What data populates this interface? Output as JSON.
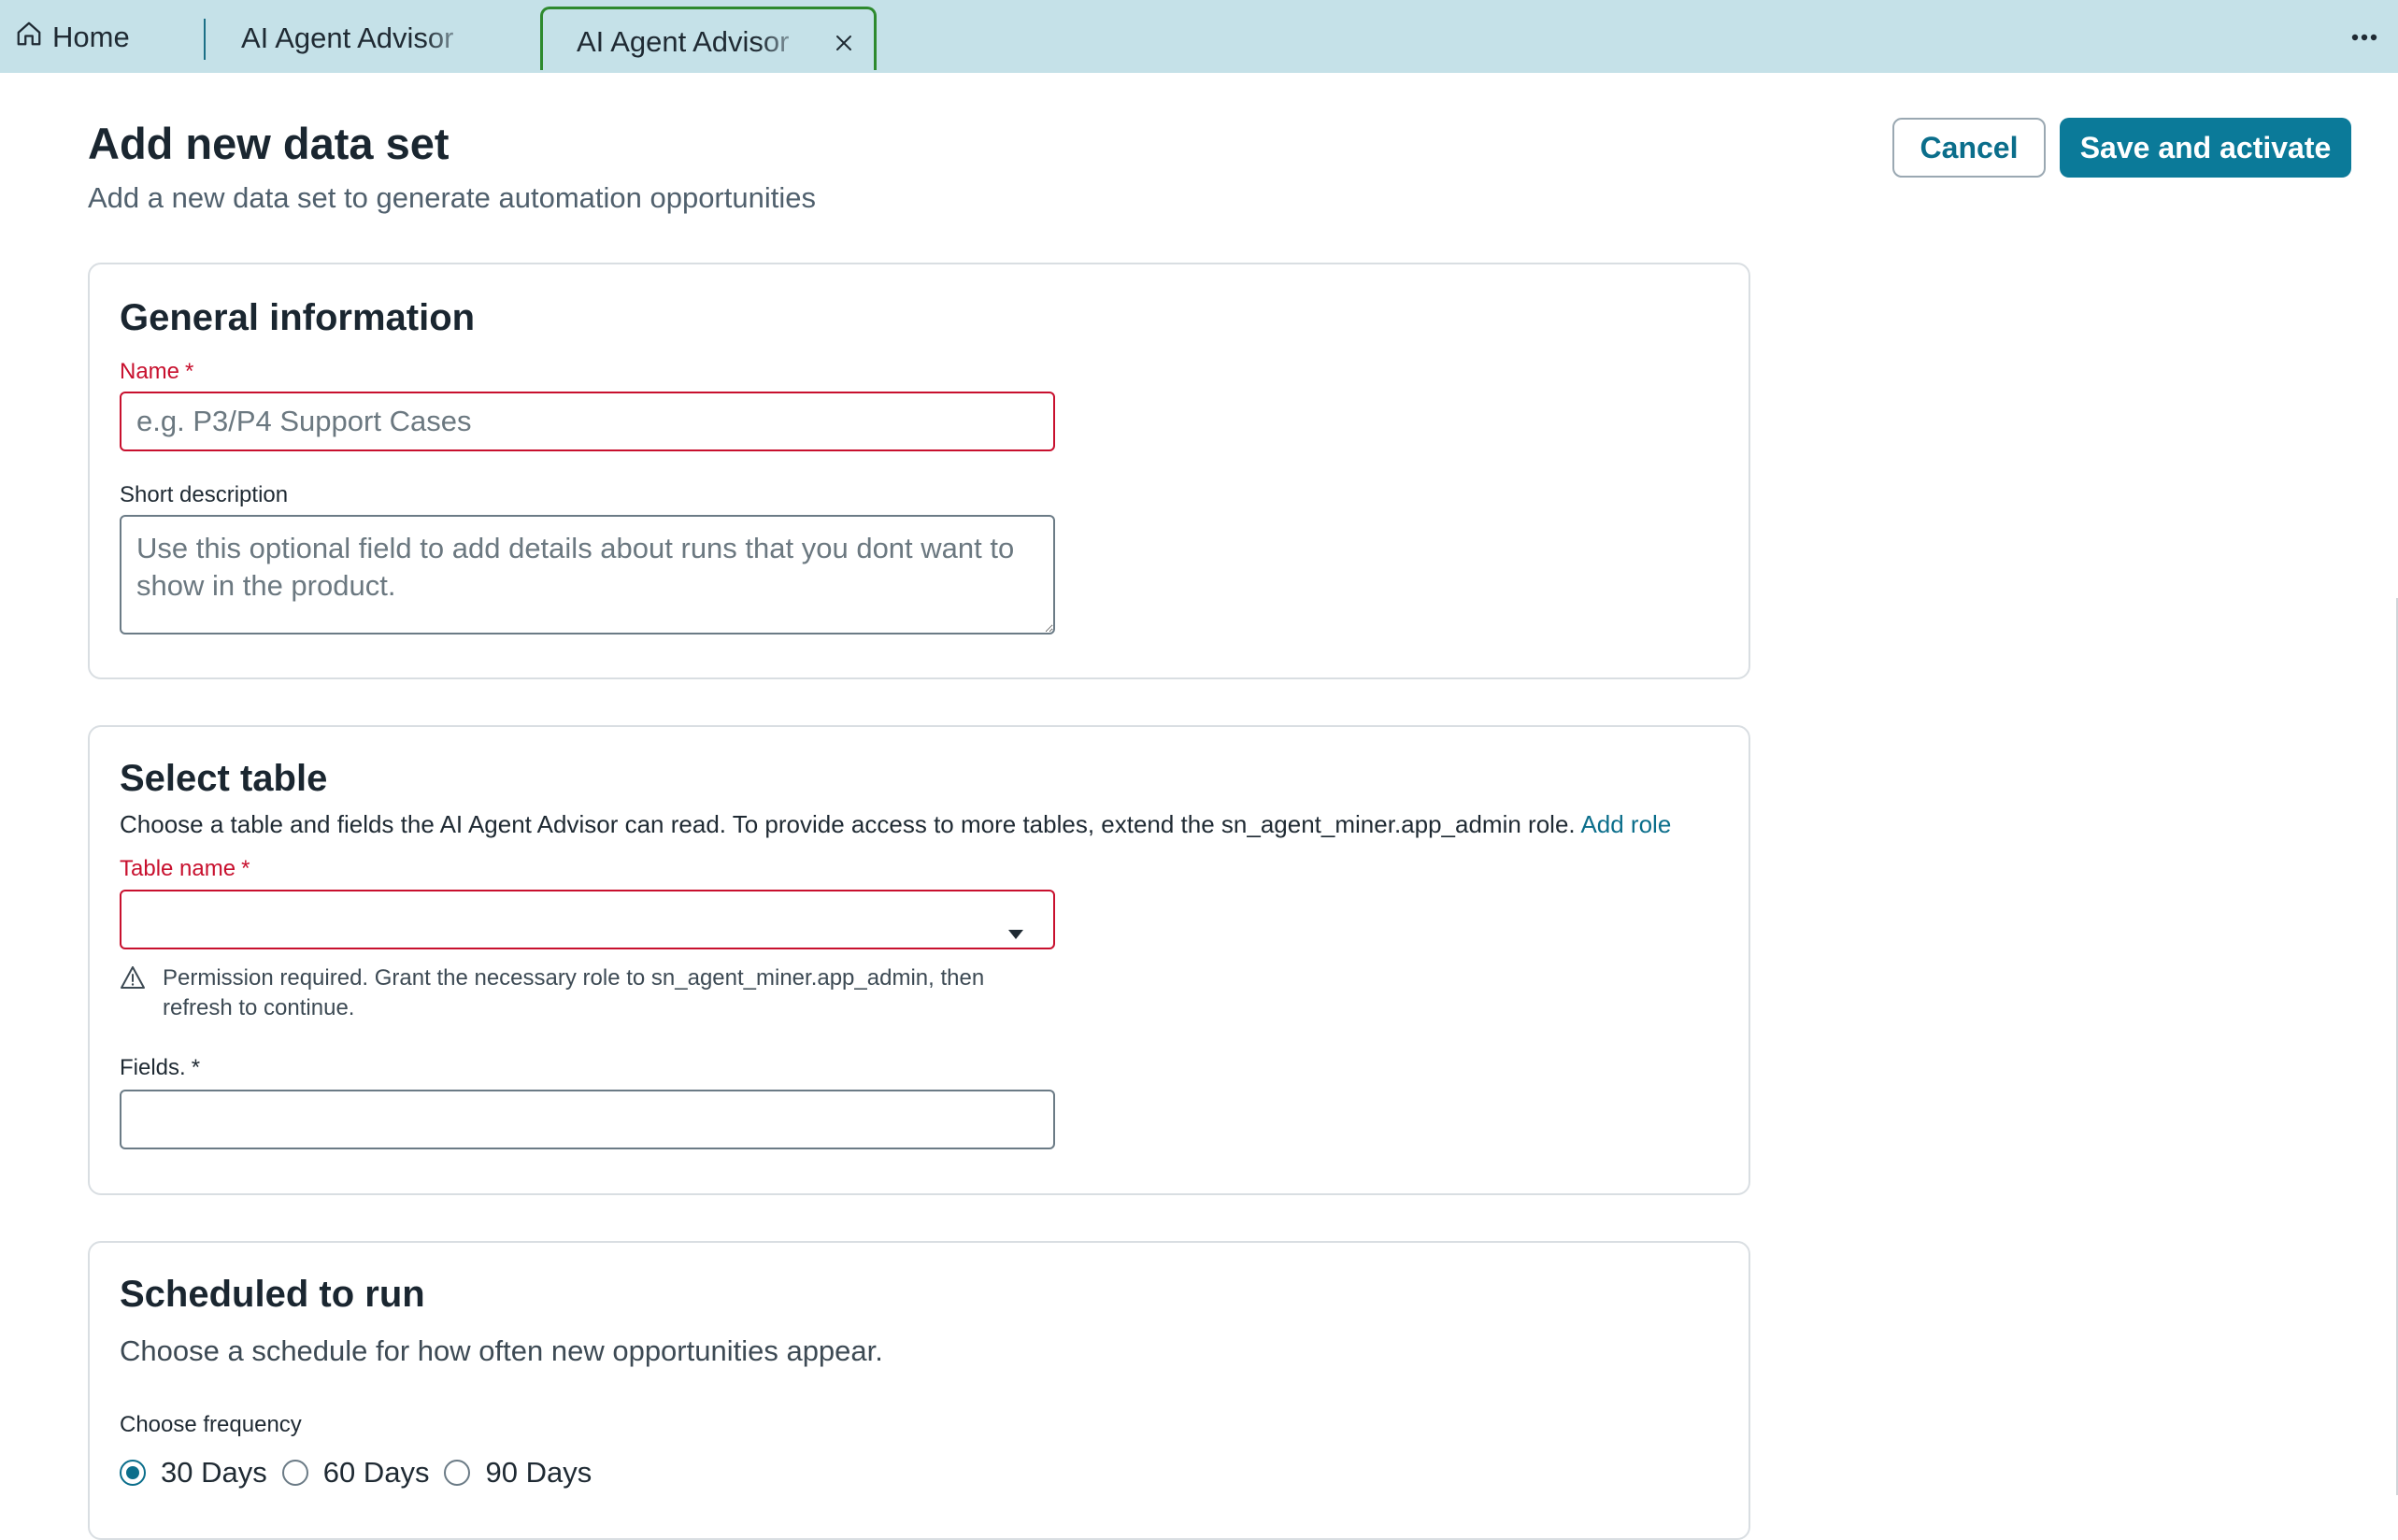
{
  "tabs": {
    "home_label": "Home",
    "tab1_label": "AI Agent Advisor",
    "tab2_label": "AI Agent Advisor",
    "active_tab_border_color": "#2e8a2e"
  },
  "header": {
    "title": "Add new data set",
    "subtitle": "Add a new data set to generate automation opportunities",
    "cancel_label": "Cancel",
    "save_label": "Save and activate"
  },
  "general": {
    "heading": "General information",
    "name_label": "Name",
    "name_placeholder": "e.g. P3/P4 Support Cases",
    "short_desc_label": "Short description",
    "short_desc_placeholder": "Use this optional field to add details about runs that you dont want to show in the product."
  },
  "table_section": {
    "heading": "Select table",
    "description": "Choose a table and fields the AI Agent Advisor can read. To provide access to more tables, extend the sn_agent_miner.app_admin role.",
    "add_role_link": "Add role",
    "table_name_label": "Table name",
    "table_name_value": "",
    "warning": "Permission required. Grant the necessary role to sn_agent_miner.app_admin, then refresh to continue.",
    "fields_label": "Fields.",
    "fields_value": ""
  },
  "schedule": {
    "heading": "Scheduled to run",
    "description": "Choose a schedule for how often new opportunities appear.",
    "frequency_label": "Choose frequency",
    "options": [
      "30 Days",
      "60 Days",
      "90 Days"
    ],
    "selected": "30 Days"
  },
  "required_marker": "*",
  "colors": {
    "tabbar_bg": "#c5e1e8",
    "primary": "#0b7a99",
    "error": "#c8102e"
  },
  "icons": {
    "home": "home-icon",
    "close": "close-icon",
    "more": "more-horizontal-icon",
    "caret": "caret-down-icon",
    "warning": "warning-triangle-icon"
  }
}
